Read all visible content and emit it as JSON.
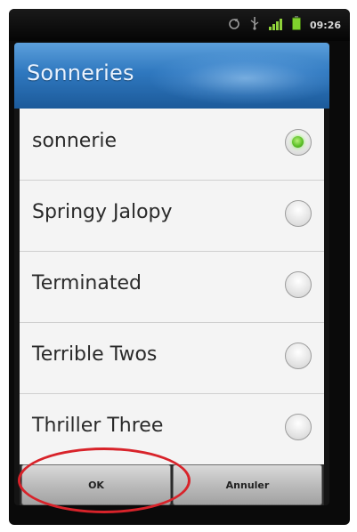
{
  "status_bar": {
    "time": "09:26",
    "icons": [
      "sync-icon",
      "usb-icon",
      "signal-icon",
      "battery-icon"
    ],
    "battery_color": "#7fd12d"
  },
  "dialog": {
    "title": "Sonneries",
    "header_color": "#2f78bf",
    "items": [
      {
        "label": "sonnerie",
        "selected": true
      },
      {
        "label": "Springy Jalopy",
        "selected": false
      },
      {
        "label": "Terminated",
        "selected": false
      },
      {
        "label": "Terrible Twos",
        "selected": false
      },
      {
        "label": "Thriller Three",
        "selected": false
      }
    ],
    "buttons": {
      "ok_label": "OK",
      "cancel_label": "Annuler"
    }
  },
  "annotation": {
    "color": "#d8232a",
    "target": "ok-button"
  }
}
